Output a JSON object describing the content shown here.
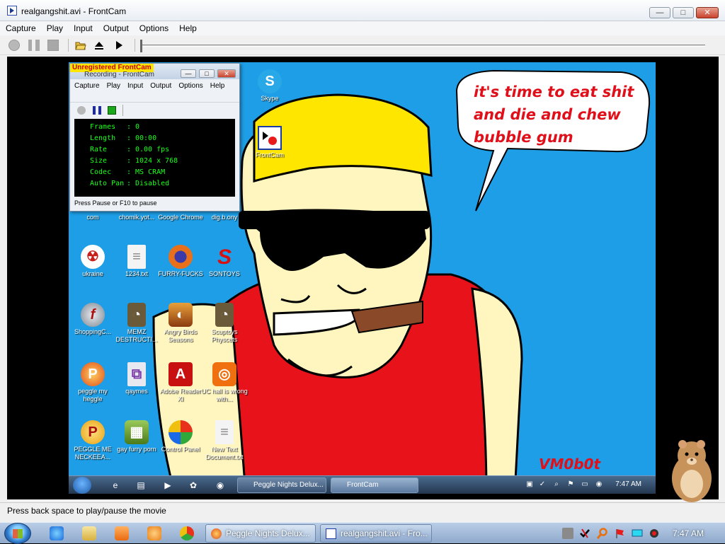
{
  "window": {
    "title": "realgangshit.avi - FrontCam",
    "controls": {
      "minimize": "—",
      "maximize": "□",
      "close": "✕"
    }
  },
  "menu": [
    "Capture",
    "Play",
    "Input",
    "Output",
    "Options",
    "Help"
  ],
  "toolbar": {
    "buttons": [
      "record-icon",
      "pause-icon",
      "stop-icon",
      "open-folder-icon",
      "eject-icon",
      "play-icon"
    ],
    "seek_position": 0
  },
  "status": "Press back space to play/pause the movie",
  "video": {
    "speech_bubble": [
      "it's time to eat shit",
      "and die and chew",
      "bubble gum"
    ],
    "signature": "VM0b0t",
    "desktop_icons": [
      {
        "label": "Skype",
        "glyph": "S",
        "color": "#29a8e8"
      },
      {
        "label": "FrontCam",
        "glyph": "▶",
        "color": "#ffffff"
      },
      {
        "label": "com",
        "glyph": "",
        "color": ""
      },
      {
        "label": "chomik.yot...",
        "glyph": "",
        "color": ""
      },
      {
        "label": "Google Chrome",
        "glyph": "",
        "color": ""
      },
      {
        "label": "dig.b.ony",
        "glyph": "",
        "color": ""
      },
      {
        "label": "ukraine",
        "glyph": "☢",
        "color": "#c8201a"
      },
      {
        "label": "1234.txt",
        "glyph": "≡",
        "color": "#f4f4f4"
      },
      {
        "label": "FURRY-FUCKS",
        "glyph": "◉",
        "color": "#e8701a"
      },
      {
        "label": "SONTOYS",
        "glyph": "S",
        "color": "#d81010"
      },
      {
        "label": "ShoppingC...",
        "glyph": "f",
        "color": "#9aa4b0"
      },
      {
        "label": "MEMZ DESTRUCTI...",
        "glyph": "◔",
        "color": "#6a5a3a"
      },
      {
        "label": "Angry Birds Seasons",
        "glyph": "◐",
        "color": "#a03a10"
      },
      {
        "label": "Scuptoys Physcets",
        "glyph": "◔",
        "color": "#6a5a3a"
      },
      {
        "label": "peggle my heggle",
        "glyph": "P",
        "color": "#e04a1a"
      },
      {
        "label": "qaymes",
        "glyph": "⧉",
        "color": "#e8e8f0"
      },
      {
        "label": "Adobe Reader XI",
        "glyph": "A",
        "color": "#c81010"
      },
      {
        "label": "UC hall is wrong with...",
        "glyph": "◎",
        "color": "#f07010"
      },
      {
        "label": "PEGGLE ME NECKEEA...",
        "glyph": "P",
        "color": "#e8a010"
      },
      {
        "label": "gay furry porn",
        "glyph": "▦",
        "color": "#5a8a2a"
      },
      {
        "label": "Control Panel",
        "glyph": "◕",
        "color": "#e8e8e8"
      },
      {
        "label": "New Text Document.txt",
        "glyph": "≡",
        "color": "#f4f4f4"
      }
    ],
    "inner_taskbar": {
      "tasks": [
        "Peggle Nights Delux...",
        "FrontCam"
      ],
      "clock": "7:47 AM"
    }
  },
  "recorder": {
    "unregistered": "Unregistered FrontCam",
    "title": "Recording - FrontCam",
    "menu": [
      "Capture",
      "Play",
      "Input",
      "Output",
      "Options",
      "Help"
    ],
    "stats": [
      {
        "key": "Frames",
        "value": "0"
      },
      {
        "key": "Length",
        "value": "00:00"
      },
      {
        "key": "Rate",
        "value": "0.00  fps"
      },
      {
        "key": "Size",
        "value": "1024 x 768"
      },
      {
        "key": "Codec",
        "value": "MS CRAM"
      },
      {
        "key": "Auto Pan",
        "value": "Disabled"
      }
    ],
    "hint": "Press Pause or F10 to pause"
  },
  "taskbar": {
    "tasks": [
      {
        "label": "Peggle Nights Delux...",
        "icon": "peggle-icon"
      },
      {
        "label": "realgangshit.avi - Fro...",
        "icon": "frontcam-icon"
      }
    ],
    "clock": "7:47 AM",
    "tray": [
      "tray-app-icon",
      "tray-check-icon",
      "tray-search-icon",
      "tray-flag-icon",
      "tray-monitor-icon",
      "tray-volume-icon"
    ]
  },
  "colors": {
    "desktop_bg": "#1e9ee6",
    "speech_red": "#e0101a",
    "terminal_green": "#1aff1a"
  }
}
